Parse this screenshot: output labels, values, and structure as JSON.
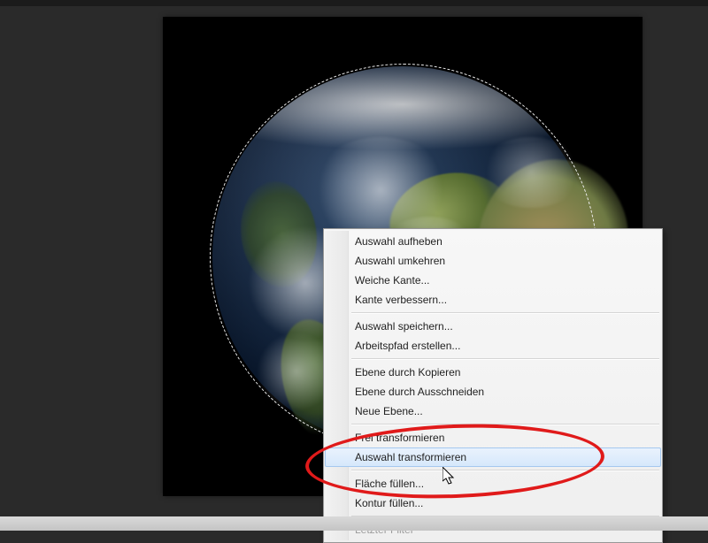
{
  "canvas": {
    "subject": "earth-globe",
    "has_selection": true
  },
  "context_menu": {
    "highlighted_index": 11,
    "items": [
      {
        "label": "Auswahl aufheben",
        "enabled": true
      },
      {
        "label": "Auswahl umkehren",
        "enabled": true
      },
      {
        "label": "Weiche Kante...",
        "enabled": true
      },
      {
        "label": "Kante verbessern...",
        "enabled": true
      },
      {
        "sep": true
      },
      {
        "label": "Auswahl speichern...",
        "enabled": true
      },
      {
        "label": "Arbeitspfad erstellen...",
        "enabled": true
      },
      {
        "sep": true
      },
      {
        "label": "Ebene durch Kopieren",
        "enabled": true
      },
      {
        "label": "Ebene durch Ausschneiden",
        "enabled": true
      },
      {
        "label": "Neue Ebene...",
        "enabled": true
      },
      {
        "sep": true
      },
      {
        "label": "Frei transformieren",
        "enabled": true
      },
      {
        "label": "Auswahl transformieren",
        "enabled": true
      },
      {
        "sep": true
      },
      {
        "label": "Fläche füllen...",
        "enabled": true
      },
      {
        "label": "Kontur füllen...",
        "enabled": true
      },
      {
        "sep": true
      },
      {
        "label": "Letzter Filter",
        "enabled": false
      }
    ]
  },
  "annotation": {
    "shape": "ellipse",
    "color": "#e01a1a",
    "targets": [
      "Frei transformieren",
      "Auswahl transformieren"
    ]
  }
}
